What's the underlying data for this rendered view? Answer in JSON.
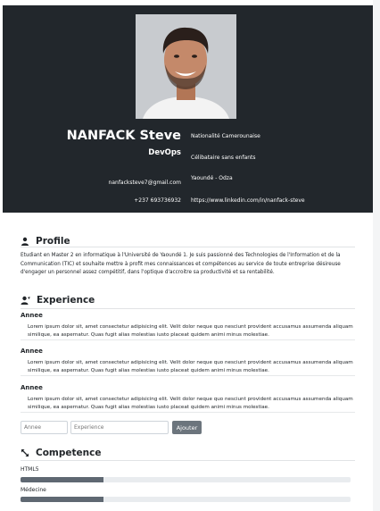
{
  "header": {
    "name": "NANFACK Steve",
    "role": "DevOps",
    "email": "nanfacksteve7@gmail.com",
    "phone": "+237 693736932",
    "nationality": "Nationalité Camerounaise",
    "status": "Célibataire sans enfants",
    "location": "Yaoundé - Odza",
    "linkedin": "https://www.linkedin.com/in/nanfack-steve"
  },
  "profile": {
    "title": "Profile",
    "text": "Etudiant en Master 2 en informatique à l'Université de Yaoundé 1. Je suis passionné des Technologies de l'Information et de la Communication (TIC) et souhaite mettre à profit mes connaissances et compétences au service de toute entreprise désireuse d'engager un personnel assez compétitif, dans l'optique d'accroitre sa productivité et sa rentabilité."
  },
  "experience": {
    "title": "Experience",
    "items": [
      {
        "year": "Annee",
        "description": "Lorem ipsum dolor sit, amet consectetur adipisicing elit. Velit dolor neque quo nesciunt provident accusamus assumenda aliquam similique, ea aspernatur. Quas fugit alias molestias iusto placeat quidem animi minus molestiae."
      },
      {
        "year": "Annee",
        "description": "Lorem ipsum dolor sit, amet consectetur adipisicing elit. Velit dolor neque quo nesciunt provident accusamus assumenda aliquam similique, ea aspernatur. Quas fugit alias molestias iusto placeat quidem animi minus molestiae."
      },
      {
        "year": "Annee",
        "description": "Lorem ipsum dolor sit, amet consectetur adipisicing elit. Velit dolor neque quo nesciunt provident accusamus assumenda aliquam similique, ea aspernatur. Quas fugit alias molestias iusto placeat quidem animi minus molestiae."
      }
    ],
    "form": {
      "year_placeholder": "Annee",
      "experience_placeholder": "Experience",
      "add_label": "Ajouter"
    }
  },
  "competence": {
    "title": "Competence",
    "skills": [
      {
        "name": "HTML5",
        "level": 0.25
      },
      {
        "name": "Médecine",
        "level": 0.25
      }
    ]
  },
  "icons": {
    "profile": "user-icon",
    "experience": "user-tie-icon",
    "competence": "expand-arrows-icon"
  },
  "colors": {
    "header_bg": "#22272c",
    "progress_fill": "#5f6872",
    "button_bg": "#6c757d"
  }
}
